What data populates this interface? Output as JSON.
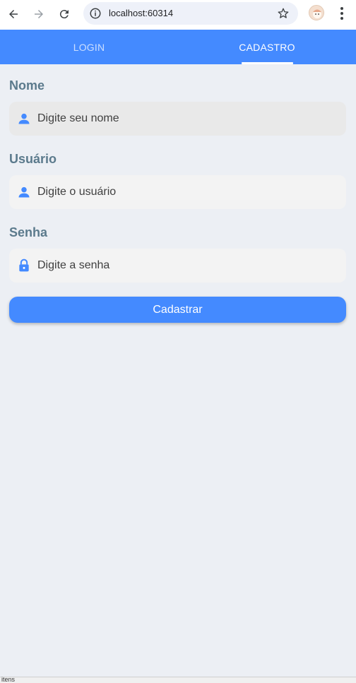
{
  "browser": {
    "url": "localhost:60314",
    "icons": [
      "back-arrow-icon",
      "forward-arrow-icon",
      "reload-icon",
      "info-icon",
      "bookmark-star-icon",
      "profile-avatar",
      "kebab-menu-icon"
    ]
  },
  "tabs": [
    {
      "label": "LOGIN",
      "active": false
    },
    {
      "label": "CADASTRO",
      "active": true
    }
  ],
  "form": {
    "name": {
      "label": "Nome",
      "placeholder": "Digite seu nome",
      "icon": "person-icon"
    },
    "user": {
      "label": "Usuário",
      "placeholder": "Digite o usuário",
      "icon": "person-icon"
    },
    "password": {
      "label": "Senha",
      "placeholder": "Digite a senha",
      "icon": "lock-icon"
    },
    "submit_label": "Cadastrar"
  },
  "status": {
    "text": "itens"
  },
  "colors": {
    "accent": "#448aff",
    "background": "#eceff4",
    "label": "#5b7a8c"
  }
}
